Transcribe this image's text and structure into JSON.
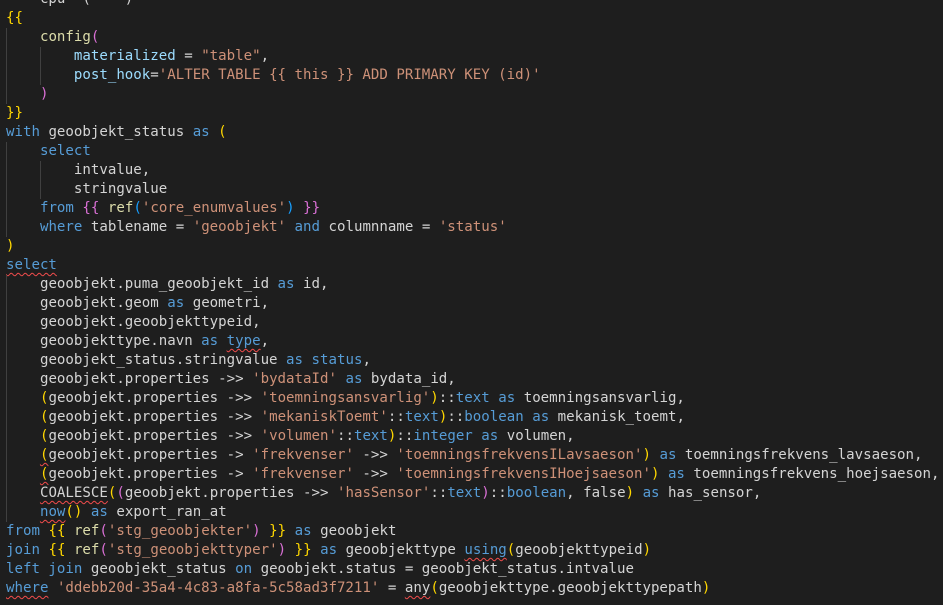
{
  "colors": {
    "background": "#1e1e1e",
    "keyword": "#569cd6",
    "control": "#c586c0",
    "string": "#ce9178",
    "identifier": "#9cdcfe",
    "function": "#dcdcaa",
    "text": "#d4d4d4",
    "brace": "#ffd700",
    "paren2": "#da70d6",
    "paren3": "#179fff",
    "error_squiggle": "#f14c4c"
  },
  "lines": [
    {
      "indent": 0,
      "tokens": [
        {
          "t": "    cpu  (    ) ",
          "c": "#d4d4d4"
        }
      ]
    },
    {
      "indent": 0,
      "tokens": [
        {
          "t": "{{",
          "c": "#ffd700"
        }
      ]
    },
    {
      "indent": 1,
      "tokens": [
        {
          "t": "config",
          "c": "#dcdcaa"
        },
        {
          "t": "(",
          "c": "#da70d6"
        }
      ]
    },
    {
      "indent": 2,
      "tokens": [
        {
          "t": "materialized",
          "c": "#9cdcfe"
        },
        {
          "t": " = ",
          "c": "#d4d4d4"
        },
        {
          "t": "\"table\"",
          "c": "#ce9178"
        },
        {
          "t": ",",
          "c": "#d4d4d4"
        }
      ]
    },
    {
      "indent": 2,
      "tokens": [
        {
          "t": "post_hook",
          "c": "#9cdcfe"
        },
        {
          "t": "=",
          "c": "#d4d4d4"
        },
        {
          "t": "'ALTER TABLE {{ this }} ADD PRIMARY KEY (id)'",
          "c": "#ce9178"
        }
      ]
    },
    {
      "indent": 1,
      "tokens": [
        {
          "t": ")",
          "c": "#da70d6"
        }
      ]
    },
    {
      "indent": 0,
      "tokens": [
        {
          "t": "}}",
          "c": "#ffd700"
        }
      ]
    },
    {
      "indent": 0,
      "tokens": [
        {
          "t": "with",
          "c": "#569cd6"
        },
        {
          "t": " geoobjekt_status ",
          "c": "#d4d4d4"
        },
        {
          "t": "as",
          "c": "#569cd6"
        },
        {
          "t": " ",
          "c": "#d4d4d4"
        },
        {
          "t": "(",
          "c": "#ffd700"
        }
      ]
    },
    {
      "indent": 1,
      "tokens": [
        {
          "t": "select",
          "c": "#569cd6"
        }
      ]
    },
    {
      "indent": 2,
      "tokens": [
        {
          "t": "intvalue,",
          "c": "#d4d4d4"
        }
      ]
    },
    {
      "indent": 2,
      "tokens": [
        {
          "t": "stringvalue",
          "c": "#d4d4d4"
        }
      ]
    },
    {
      "indent": 1,
      "tokens": [
        {
          "t": "from",
          "c": "#569cd6"
        },
        {
          "t": " ",
          "c": "#d4d4d4"
        },
        {
          "t": "{{",
          "c": "#da70d6"
        },
        {
          "t": " ",
          "c": "#d4d4d4"
        },
        {
          "t": "ref",
          "c": "#dcdcaa"
        },
        {
          "t": "(",
          "c": "#179fff"
        },
        {
          "t": "'core_enumvalues'",
          "c": "#ce9178"
        },
        {
          "t": ")",
          "c": "#179fff"
        },
        {
          "t": " ",
          "c": "#d4d4d4"
        },
        {
          "t": "}}",
          "c": "#da70d6"
        }
      ]
    },
    {
      "indent": 1,
      "tokens": [
        {
          "t": "where",
          "c": "#569cd6"
        },
        {
          "t": " tablename = ",
          "c": "#d4d4d4"
        },
        {
          "t": "'geoobjekt'",
          "c": "#ce9178"
        },
        {
          "t": " ",
          "c": "#d4d4d4"
        },
        {
          "t": "and",
          "c": "#569cd6"
        },
        {
          "t": " columnname = ",
          "c": "#d4d4d4"
        },
        {
          "t": "'status'",
          "c": "#ce9178"
        }
      ]
    },
    {
      "indent": 0,
      "tokens": [
        {
          "t": ")",
          "c": "#ffd700"
        }
      ]
    },
    {
      "indent": 0,
      "tokens": [
        {
          "t": "select",
          "c": "#569cd6",
          "sq": true
        }
      ]
    },
    {
      "indent": 1,
      "tokens": [
        {
          "t": "geoobjekt.puma_geoobjekt_id ",
          "c": "#d4d4d4"
        },
        {
          "t": "as",
          "c": "#569cd6"
        },
        {
          "t": " id,",
          "c": "#d4d4d4"
        }
      ]
    },
    {
      "indent": 1,
      "tokens": [
        {
          "t": "geoobjekt.geom ",
          "c": "#d4d4d4"
        },
        {
          "t": "as",
          "c": "#569cd6"
        },
        {
          "t": " geometri,",
          "c": "#d4d4d4"
        }
      ]
    },
    {
      "indent": 1,
      "tokens": [
        {
          "t": "geoobjekt.geoobjekttypeid,",
          "c": "#d4d4d4"
        }
      ]
    },
    {
      "indent": 1,
      "tokens": [
        {
          "t": "geoobjekttype.navn ",
          "c": "#d4d4d4"
        },
        {
          "t": "as",
          "c": "#569cd6"
        },
        {
          "t": " ",
          "c": "#d4d4d4"
        },
        {
          "t": "type",
          "c": "#569cd6",
          "sq": true
        },
        {
          "t": ",",
          "c": "#d4d4d4"
        }
      ]
    },
    {
      "indent": 1,
      "tokens": [
        {
          "t": "geoobjekt_status.stringvalue ",
          "c": "#d4d4d4"
        },
        {
          "t": "as",
          "c": "#569cd6"
        },
        {
          "t": " ",
          "c": "#d4d4d4"
        },
        {
          "t": "status",
          "c": "#569cd6"
        },
        {
          "t": ",",
          "c": "#d4d4d4"
        }
      ]
    },
    {
      "indent": 1,
      "tokens": [
        {
          "t": "geoobjekt.properties ->> ",
          "c": "#d4d4d4"
        },
        {
          "t": "'bydataId'",
          "c": "#ce9178"
        },
        {
          "t": " ",
          "c": "#d4d4d4"
        },
        {
          "t": "as",
          "c": "#569cd6"
        },
        {
          "t": " bydata_id,",
          "c": "#d4d4d4"
        }
      ]
    },
    {
      "indent": 1,
      "tokens": [
        {
          "t": "(",
          "c": "#ffd700"
        },
        {
          "t": "geoobjekt.properties ->> ",
          "c": "#d4d4d4"
        },
        {
          "t": "'toemningsansvarlig'",
          "c": "#ce9178"
        },
        {
          "t": ")",
          "c": "#ffd700"
        },
        {
          "t": "::",
          "c": "#d4d4d4"
        },
        {
          "t": "text",
          "c": "#569cd6"
        },
        {
          "t": " ",
          "c": "#d4d4d4"
        },
        {
          "t": "as",
          "c": "#569cd6"
        },
        {
          "t": " toemningsansvarlig,",
          "c": "#d4d4d4"
        }
      ]
    },
    {
      "indent": 1,
      "tokens": [
        {
          "t": "(",
          "c": "#ffd700"
        },
        {
          "t": "geoobjekt.properties ->> ",
          "c": "#d4d4d4"
        },
        {
          "t": "'mekaniskToemt'",
          "c": "#ce9178"
        },
        {
          "t": "::",
          "c": "#d4d4d4"
        },
        {
          "t": "text",
          "c": "#569cd6"
        },
        {
          "t": ")",
          "c": "#ffd700"
        },
        {
          "t": "::",
          "c": "#d4d4d4"
        },
        {
          "t": "boolean",
          "c": "#569cd6"
        },
        {
          "t": " ",
          "c": "#d4d4d4"
        },
        {
          "t": "as",
          "c": "#569cd6"
        },
        {
          "t": " mekanisk_toemt,",
          "c": "#d4d4d4"
        }
      ]
    },
    {
      "indent": 1,
      "tokens": [
        {
          "t": "(",
          "c": "#ffd700"
        },
        {
          "t": "geoobjekt.properties ->> ",
          "c": "#d4d4d4"
        },
        {
          "t": "'volumen'",
          "c": "#ce9178"
        },
        {
          "t": "::",
          "c": "#d4d4d4"
        },
        {
          "t": "text",
          "c": "#569cd6"
        },
        {
          "t": ")",
          "c": "#ffd700"
        },
        {
          "t": "::",
          "c": "#d4d4d4"
        },
        {
          "t": "integer",
          "c": "#569cd6"
        },
        {
          "t": " ",
          "c": "#d4d4d4"
        },
        {
          "t": "as",
          "c": "#569cd6"
        },
        {
          "t": " volumen,",
          "c": "#d4d4d4"
        }
      ]
    },
    {
      "indent": 1,
      "tokens": [
        {
          "t": "(",
          "c": "#ffd700",
          "sq": true
        },
        {
          "t": "geoobjekt.properties -> ",
          "c": "#d4d4d4"
        },
        {
          "t": "'frekvenser'",
          "c": "#ce9178"
        },
        {
          "t": " ->> ",
          "c": "#d4d4d4"
        },
        {
          "t": "'toemningsfrekvensILavsaeson'",
          "c": "#ce9178"
        },
        {
          "t": ")",
          "c": "#ffd700"
        },
        {
          "t": " ",
          "c": "#d4d4d4"
        },
        {
          "t": "as",
          "c": "#569cd6"
        },
        {
          "t": " toemningsfrekvens_lavsaeson,",
          "c": "#d4d4d4"
        }
      ]
    },
    {
      "indent": 1,
      "tokens": [
        {
          "t": "(",
          "c": "#ffd700",
          "sq": true
        },
        {
          "t": "geoobjekt.properties -> ",
          "c": "#d4d4d4"
        },
        {
          "t": "'frekvenser'",
          "c": "#ce9178"
        },
        {
          "t": " ->> ",
          "c": "#d4d4d4"
        },
        {
          "t": "'toemningsfrekvensIHoejsaeson'",
          "c": "#ce9178"
        },
        {
          "t": ")",
          "c": "#ffd700"
        },
        {
          "t": " ",
          "c": "#d4d4d4"
        },
        {
          "t": "as",
          "c": "#569cd6"
        },
        {
          "t": " toemningsfrekvens_hoejsaeson,",
          "c": "#d4d4d4"
        }
      ]
    },
    {
      "indent": 1,
      "tokens": [
        {
          "t": "COALESCE",
          "c": "#d4d4d4",
          "sq": true
        },
        {
          "t": "(",
          "c": "#ffd700"
        },
        {
          "t": "(",
          "c": "#da70d6"
        },
        {
          "t": "geoobjekt.properties ->> ",
          "c": "#d4d4d4"
        },
        {
          "t": "'hasSensor'",
          "c": "#ce9178"
        },
        {
          "t": "::",
          "c": "#d4d4d4"
        },
        {
          "t": "text",
          "c": "#569cd6"
        },
        {
          "t": ")",
          "c": "#da70d6"
        },
        {
          "t": "::",
          "c": "#d4d4d4"
        },
        {
          "t": "boolean",
          "c": "#569cd6"
        },
        {
          "t": ", false",
          "c": "#d4d4d4"
        },
        {
          "t": ")",
          "c": "#ffd700"
        },
        {
          "t": " ",
          "c": "#d4d4d4"
        },
        {
          "t": "as",
          "c": "#569cd6"
        },
        {
          "t": " has_sensor,",
          "c": "#d4d4d4"
        }
      ]
    },
    {
      "indent": 1,
      "tokens": [
        {
          "t": "now",
          "c": "#569cd6",
          "sq": true
        },
        {
          "t": "()",
          "c": "#ffd700"
        },
        {
          "t": " ",
          "c": "#d4d4d4"
        },
        {
          "t": "as",
          "c": "#569cd6"
        },
        {
          "t": " export_ran_at",
          "c": "#d4d4d4"
        }
      ]
    },
    {
      "indent": 0,
      "tokens": [
        {
          "t": "from",
          "c": "#569cd6"
        },
        {
          "t": " ",
          "c": "#d4d4d4"
        },
        {
          "t": "{{",
          "c": "#ffd700"
        },
        {
          "t": " ",
          "c": "#d4d4d4"
        },
        {
          "t": "ref",
          "c": "#dcdcaa"
        },
        {
          "t": "(",
          "c": "#da70d6"
        },
        {
          "t": "'stg_geoobjekter'",
          "c": "#ce9178"
        },
        {
          "t": ")",
          "c": "#da70d6"
        },
        {
          "t": " ",
          "c": "#d4d4d4"
        },
        {
          "t": "}}",
          "c": "#ffd700"
        },
        {
          "t": " ",
          "c": "#d4d4d4"
        },
        {
          "t": "as",
          "c": "#569cd6"
        },
        {
          "t": " geoobjekt",
          "c": "#d4d4d4"
        }
      ]
    },
    {
      "indent": 0,
      "tokens": [
        {
          "t": "join",
          "c": "#569cd6"
        },
        {
          "t": " ",
          "c": "#d4d4d4"
        },
        {
          "t": "{{",
          "c": "#ffd700"
        },
        {
          "t": " ",
          "c": "#d4d4d4"
        },
        {
          "t": "ref",
          "c": "#dcdcaa"
        },
        {
          "t": "(",
          "c": "#da70d6"
        },
        {
          "t": "'stg_geoobjekttyper'",
          "c": "#ce9178"
        },
        {
          "t": ")",
          "c": "#da70d6"
        },
        {
          "t": " ",
          "c": "#d4d4d4"
        },
        {
          "t": "}}",
          "c": "#ffd700"
        },
        {
          "t": " ",
          "c": "#d4d4d4"
        },
        {
          "t": "as",
          "c": "#569cd6"
        },
        {
          "t": " geoobjekttype ",
          "c": "#d4d4d4"
        },
        {
          "t": "using",
          "c": "#569cd6",
          "sq": true
        },
        {
          "t": "(",
          "c": "#ffd700"
        },
        {
          "t": "geoobjekttypeid",
          "c": "#d4d4d4"
        },
        {
          "t": ")",
          "c": "#ffd700"
        }
      ]
    },
    {
      "indent": 0,
      "tokens": [
        {
          "t": "left join",
          "c": "#569cd6"
        },
        {
          "t": " geoobjekt_status ",
          "c": "#d4d4d4"
        },
        {
          "t": "on",
          "c": "#569cd6"
        },
        {
          "t": " geoobjekt.status = geoobjekt_status.intvalue",
          "c": "#d4d4d4"
        }
      ]
    },
    {
      "indent": 0,
      "tokens": [
        {
          "t": "where",
          "c": "#569cd6",
          "sq": true
        },
        {
          "t": " ",
          "c": "#d4d4d4"
        },
        {
          "t": "'ddebb20d-35a4-4c83-a8fa-5c58ad3f7211'",
          "c": "#ce9178"
        },
        {
          "t": " = ",
          "c": "#d4d4d4"
        },
        {
          "t": "any",
          "c": "#d4d4d4",
          "sq": true
        },
        {
          "t": "(",
          "c": "#ffd700"
        },
        {
          "t": "geoobjekttype.geoobjekttypepath",
          "c": "#d4d4d4"
        },
        {
          "t": ")",
          "c": "#ffd700"
        }
      ]
    }
  ]
}
